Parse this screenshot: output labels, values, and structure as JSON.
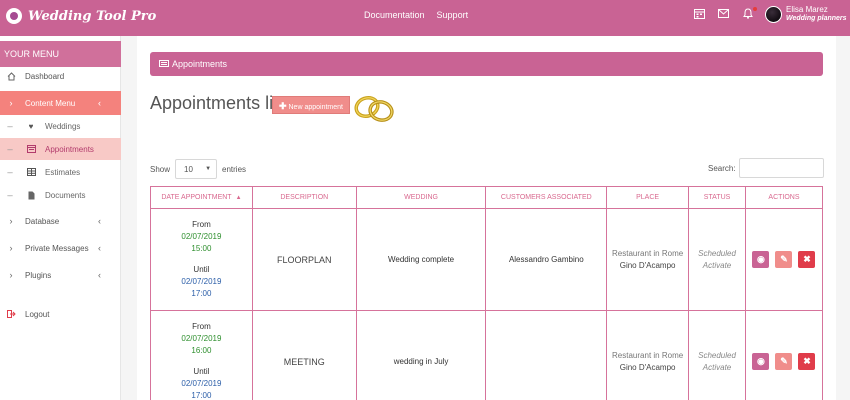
{
  "app": {
    "title": "Wedding Tool Pro",
    "nav": [
      "Documentation",
      "Support"
    ],
    "user": {
      "name": "Elisa Marez",
      "role": "Wedding planners"
    }
  },
  "sidebar": {
    "header": "YOUR MENU",
    "items": [
      {
        "label": "Dashboard",
        "icon": "home-icon"
      },
      {
        "label": "Content Menu",
        "icon": "chevron-right-icon"
      },
      {
        "label": "Weddings",
        "icon": "heart-icon"
      },
      {
        "label": "Appointments",
        "icon": "calendar-icon"
      },
      {
        "label": "Estimates",
        "icon": "table-icon"
      },
      {
        "label": "Documents",
        "icon": "document-icon"
      },
      {
        "label": "Database",
        "icon": "chevron-right-icon"
      },
      {
        "label": "Private Messages",
        "icon": "chevron-right-icon"
      },
      {
        "label": "Plugins",
        "icon": "chevron-right-icon"
      },
      {
        "label": "Logout",
        "icon": "logout-icon"
      }
    ]
  },
  "breadcrumb": "Appointments",
  "page": {
    "title": "Appointments list",
    "new_button": "New appointment"
  },
  "table_controls": {
    "show_label": "Show",
    "page_size": "10",
    "entries_label": "entries",
    "search_label": "Search:"
  },
  "table": {
    "columns": [
      "DATE APPOINTMENT",
      "DESCRIPTION",
      "WEDDING",
      "CUSTOMERS ASSOCIATED",
      "PLACE",
      "STATUS",
      "ACTIONS"
    ],
    "rows": [
      {
        "from_label": "From",
        "from_date": "02/07/2019",
        "from_time": "15:00",
        "until_label": "Until",
        "until_date": "02/07/2019",
        "until_time": "17:00",
        "description": "FLOORPLAN",
        "wedding": "Wedding complete",
        "customers": "Alessandro Gambino",
        "place_name": "Restaurant in Rome",
        "place_person": "Gino D'Acampo",
        "status_1": "Scheduled",
        "status_2": "Activate"
      },
      {
        "from_label": "From",
        "from_date": "02/07/2019",
        "from_time": "16:00",
        "until_label": "Until",
        "until_date": "02/07/2019",
        "until_time": "17:00",
        "description": "MEETING",
        "wedding": "wedding in July",
        "customers": "",
        "place_name": "Restaurant in Rome",
        "place_person": "Gino D'Acampo",
        "status_1": "Scheduled",
        "status_2": "Activate"
      }
    ]
  },
  "colors": {
    "brand": "#c96394",
    "accent": "#f4827d",
    "date_from": "#2e8f2e",
    "date_until": "#2b5ea8",
    "delete": "#e03c4a"
  }
}
